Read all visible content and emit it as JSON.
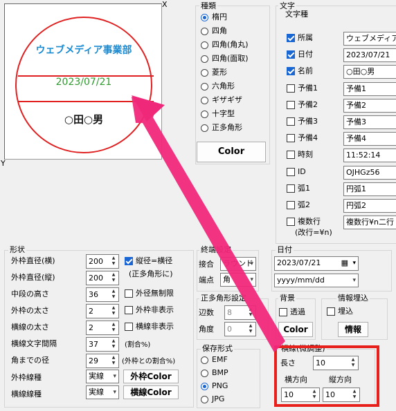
{
  "preview": {
    "axis_x": "X",
    "axis_y": "Y",
    "stamp_top": "ウェブメディア事業部",
    "stamp_date": "2023/07/21",
    "stamp_name": "○田○男",
    "top_color": "#1a8ad1",
    "date_color": "#2e9a2e",
    "ring_color": "#e02020"
  },
  "shape_type": {
    "title": "種類",
    "options": [
      "楕円",
      "四角",
      "四角(角丸)",
      "四角(面取)",
      "菱形",
      "六角形",
      "ギザギザ",
      "十字型",
      "正多角形"
    ],
    "selected": 0,
    "color_button": "Color"
  },
  "text_panel": {
    "title": "文字",
    "subtitle": "文字種",
    "rows": [
      {
        "label": "所属",
        "checked": true,
        "value": "ウェブメディア事"
      },
      {
        "label": "日付",
        "checked": true,
        "value": "2023/07/21"
      },
      {
        "label": "名前",
        "checked": true,
        "value": "○田○男"
      },
      {
        "label": "予備1",
        "checked": false,
        "value": "予備1"
      },
      {
        "label": "予備2",
        "checked": false,
        "value": "予備2"
      },
      {
        "label": "予備3",
        "checked": false,
        "value": "予備3"
      },
      {
        "label": "予備4",
        "checked": false,
        "value": "予備4"
      },
      {
        "label": "時刻",
        "checked": false,
        "value": "11:52:14"
      },
      {
        "label": "ID",
        "checked": false,
        "value": "OJHGz56"
      },
      {
        "label": "弧1",
        "checked": false,
        "value": "円弧1"
      },
      {
        "label": "弧2",
        "checked": false,
        "value": "円弧2"
      },
      {
        "label": "複数行",
        "checked": false,
        "value": "複数行¥n二行"
      }
    ],
    "multiline_note": "(改行=¥n)"
  },
  "shape_panel": {
    "title": "形状",
    "rows": [
      {
        "label": "外枠直径(横)",
        "value": "200"
      },
      {
        "label": "外枠直径(縦)",
        "value": "200"
      },
      {
        "label": "中段の高さ",
        "value": "36"
      },
      {
        "label": "外枠の太さ",
        "value": "2"
      },
      {
        "label": "横線の太さ",
        "value": "2"
      },
      {
        "label": "横線文字間隔",
        "value": "37"
      },
      {
        "label": "角までの径",
        "value": "29"
      }
    ],
    "options": [
      {
        "label": "縦径=横径",
        "checked": true
      },
      {
        "label": "外径無制限",
        "checked": false
      },
      {
        "label": "外枠非表示",
        "checked": false
      },
      {
        "label": "横線非表示",
        "checked": false
      }
    ],
    "note_polygon": "(正多角形に)",
    "note_ratio": "(割合%)",
    "note_outer_ratio": "(外枠との割合%)",
    "outer_line_label": "外枠線種",
    "outer_line_value": "実線",
    "outer_color_button": "外枠Color",
    "hline_label": "横線線種",
    "hline_value": "実線",
    "hline_color_button": "横線Color"
  },
  "endpoint": {
    "title": "終端設定",
    "join_label": "接合",
    "join_value": "ラウンド",
    "end_label": "端点",
    "end_value": "角"
  },
  "date_panel": {
    "title": "日付",
    "date_value": "2023/07/21",
    "format_value": "yyyy/mm/dd"
  },
  "polygon": {
    "title": "正多角形設定",
    "sides_label": "辺数",
    "sides_value": "8",
    "angle_label": "角度",
    "angle_value": "0"
  },
  "background": {
    "title": "背景",
    "transparent_label": "透過",
    "color_button": "Color"
  },
  "embed": {
    "title": "情報埋込",
    "embed_label": "埋込",
    "info_button": "情報"
  },
  "save_format": {
    "title": "保存形式",
    "options": [
      "EMF",
      "BMP",
      "PNG",
      "JPG"
    ],
    "selected": 2
  },
  "hline_adjust": {
    "title": "横線(微調整)",
    "length_label": "長さ",
    "length_value": "10",
    "h_label": "横方向",
    "h_value": "10",
    "v_label": "縦方向",
    "v_value": "10"
  }
}
